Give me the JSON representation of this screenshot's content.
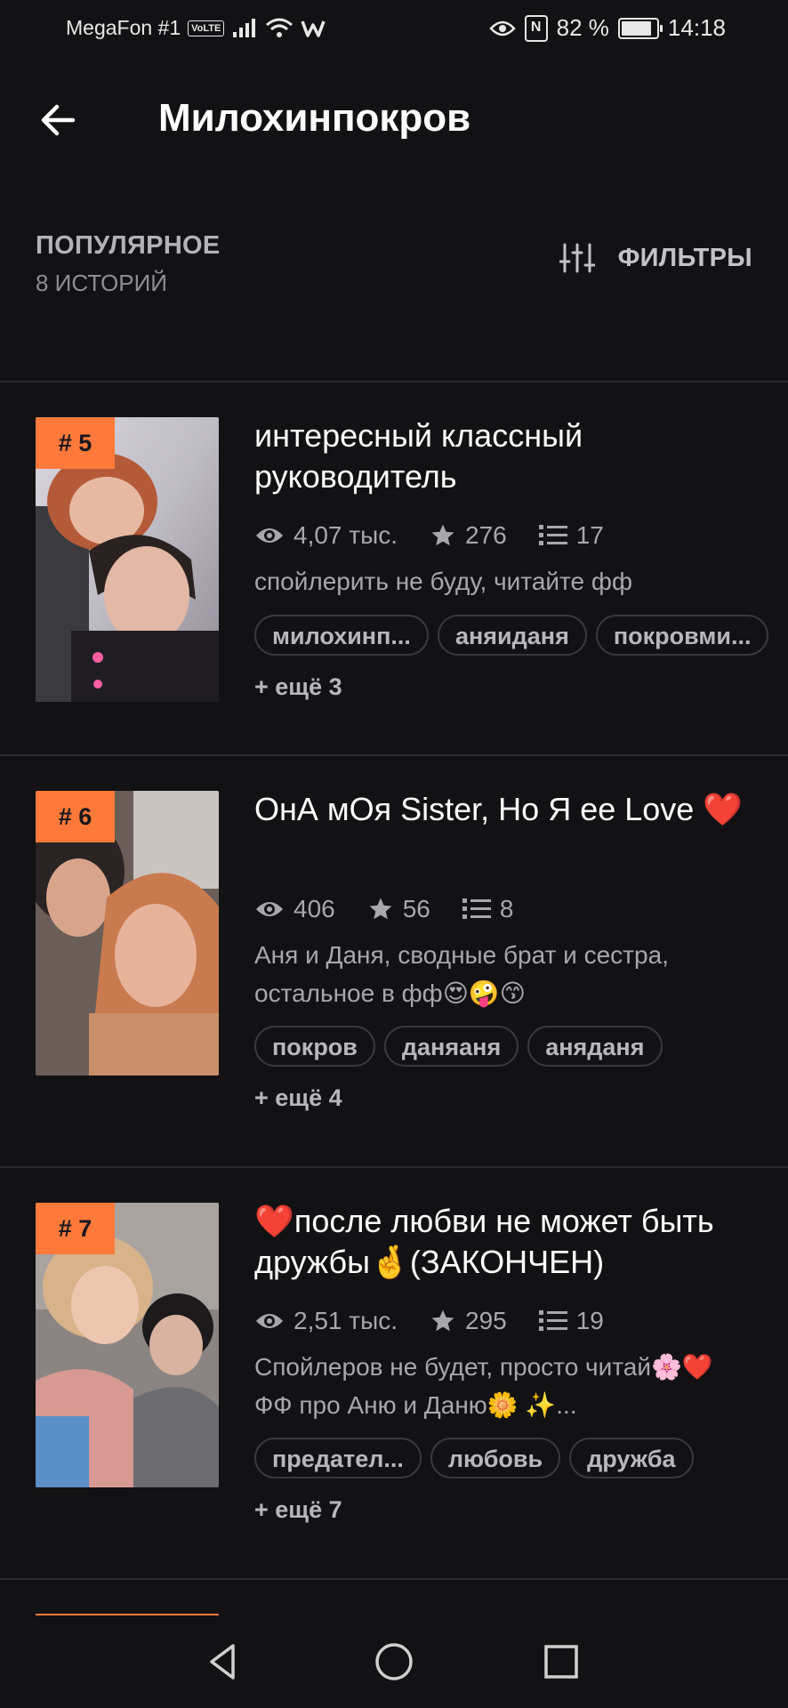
{
  "status_bar": {
    "carrier": "MegaFon #1",
    "volte": "VoLTE",
    "battery_percent": "82 %",
    "time": "14:18"
  },
  "header": {
    "title": "Милохинпокров"
  },
  "section": {
    "title": "ПОПУЛЯРНОЕ",
    "subtitle": "8 ИСТОРИЙ",
    "filter_label": "ФИЛЬТРЫ"
  },
  "stories": [
    {
      "rank": "# 5",
      "title": "интересный классный руководитель",
      "views": "4,07 тыс.",
      "stars": "276",
      "parts": "17",
      "description": "спойлерить не буду, читайте фф",
      "tags": [
        "милохинп...",
        "аняиданя",
        "покровми..."
      ],
      "more": "+ ещё 3"
    },
    {
      "rank": "# 6",
      "title": "ОнА мОя Sister, Но Я ее Love ❤️",
      "views": "406",
      "stars": "56",
      "parts": "8",
      "description": "Аня и Даня, сводные брат и сестра, остальное в фф😍🤪😙",
      "tags": [
        "покров",
        "даняаня",
        "аняданя"
      ],
      "more": "+ ещё 4"
    },
    {
      "rank": "# 7",
      "title": "❤️после любви не может быть дружбы🤞(ЗАКОНЧЕН)",
      "views": "2,51 тыс.",
      "stars": "295",
      "parts": "19",
      "description": "Спойлеров не будет, просто читай🌸❤️ ФФ про Аню и Даню🌼 ✨...",
      "tags": [
        "предател...",
        "любовь",
        "дружба"
      ],
      "more": "+ ещё 7"
    }
  ],
  "colors": {
    "background": "#121114",
    "accent": "#ff7a3a",
    "text_primary": "#ffffff",
    "text_secondary": "#a8a7ac",
    "divider": "#2b2a2e"
  },
  "icons": [
    "back-arrow-icon",
    "filter-sliders-icon",
    "eye-icon",
    "star-icon",
    "list-icon",
    "nav-back-icon",
    "nav-home-icon",
    "nav-recents-icon"
  ]
}
